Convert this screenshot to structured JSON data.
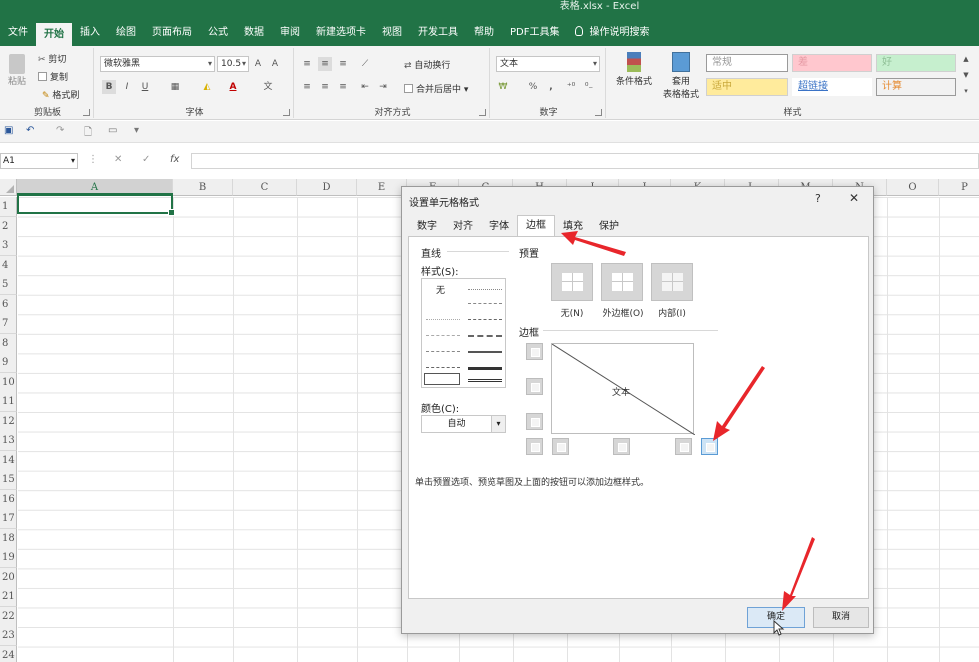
{
  "window": {
    "title": "表格.xlsx  -  Excel"
  },
  "ribbon_tabs": [
    "文件",
    "开始",
    "插入",
    "绘图",
    "页面布局",
    "公式",
    "数据",
    "审阅",
    "新建选项卡",
    "视图",
    "开发工具",
    "帮助",
    "PDF工具集",
    "操作说明搜索"
  ],
  "clipboard": {
    "paste": "粘贴",
    "cut": "剪切",
    "copy": "复制",
    "format_painter": "格式刷",
    "group_label": "剪贴板"
  },
  "font": {
    "name": "微软雅黑",
    "size": "10.5",
    "bold": "B",
    "italic": "I",
    "underline": "U",
    "group_label": "字体"
  },
  "alignment": {
    "wrap": "自动换行",
    "merge": "合并后居中",
    "group_label": "对齐方式"
  },
  "number": {
    "format": "文本",
    "percent": "%",
    "comma": ",",
    "group_label": "数字"
  },
  "styles": {
    "conditional": "条件格式",
    "table_format_1": "套用",
    "table_format_2": "表格格式",
    "cells": [
      "常规",
      "差",
      "好",
      "适中",
      "超链接",
      "计算"
    ],
    "group_label": "样式"
  },
  "formula_bar": {
    "name_box": "A1",
    "cancel": "✕",
    "enter": "✓",
    "fx": "fx",
    "value": ""
  },
  "columns": [
    "A",
    "B",
    "C",
    "D",
    "E",
    "F",
    "G",
    "H",
    "I",
    "J",
    "K",
    "L",
    "M",
    "N",
    "O",
    "P"
  ],
  "rows": [
    "1",
    "2",
    "3",
    "4",
    "5",
    "6",
    "7",
    "8",
    "9",
    "10",
    "11",
    "12",
    "13",
    "14",
    "15",
    "16",
    "17",
    "18",
    "19",
    "20",
    "21",
    "22",
    "23",
    "24"
  ],
  "dialog": {
    "title": "设置单元格格式",
    "help": "?",
    "close": "✕",
    "tabs": [
      "数字",
      "对齐",
      "字体",
      "边框",
      "填充",
      "保护"
    ],
    "active_tab": "边框",
    "line_section": "直线",
    "style_label": "样式(S):",
    "none_style": "无",
    "color_label": "颜色(C):",
    "color_value": "自动",
    "preset_section": "预置",
    "presets": [
      "无(N)",
      "外边框(O)",
      "内部(I)"
    ],
    "border_section": "边框",
    "preview_text": "文本",
    "hint": "单击预置选项、预览草图及上面的按钮可以添加边框样式。",
    "ok": "确定",
    "cancel": "取消"
  },
  "accent_color": "#217346",
  "annotation_color": "#e8262b"
}
